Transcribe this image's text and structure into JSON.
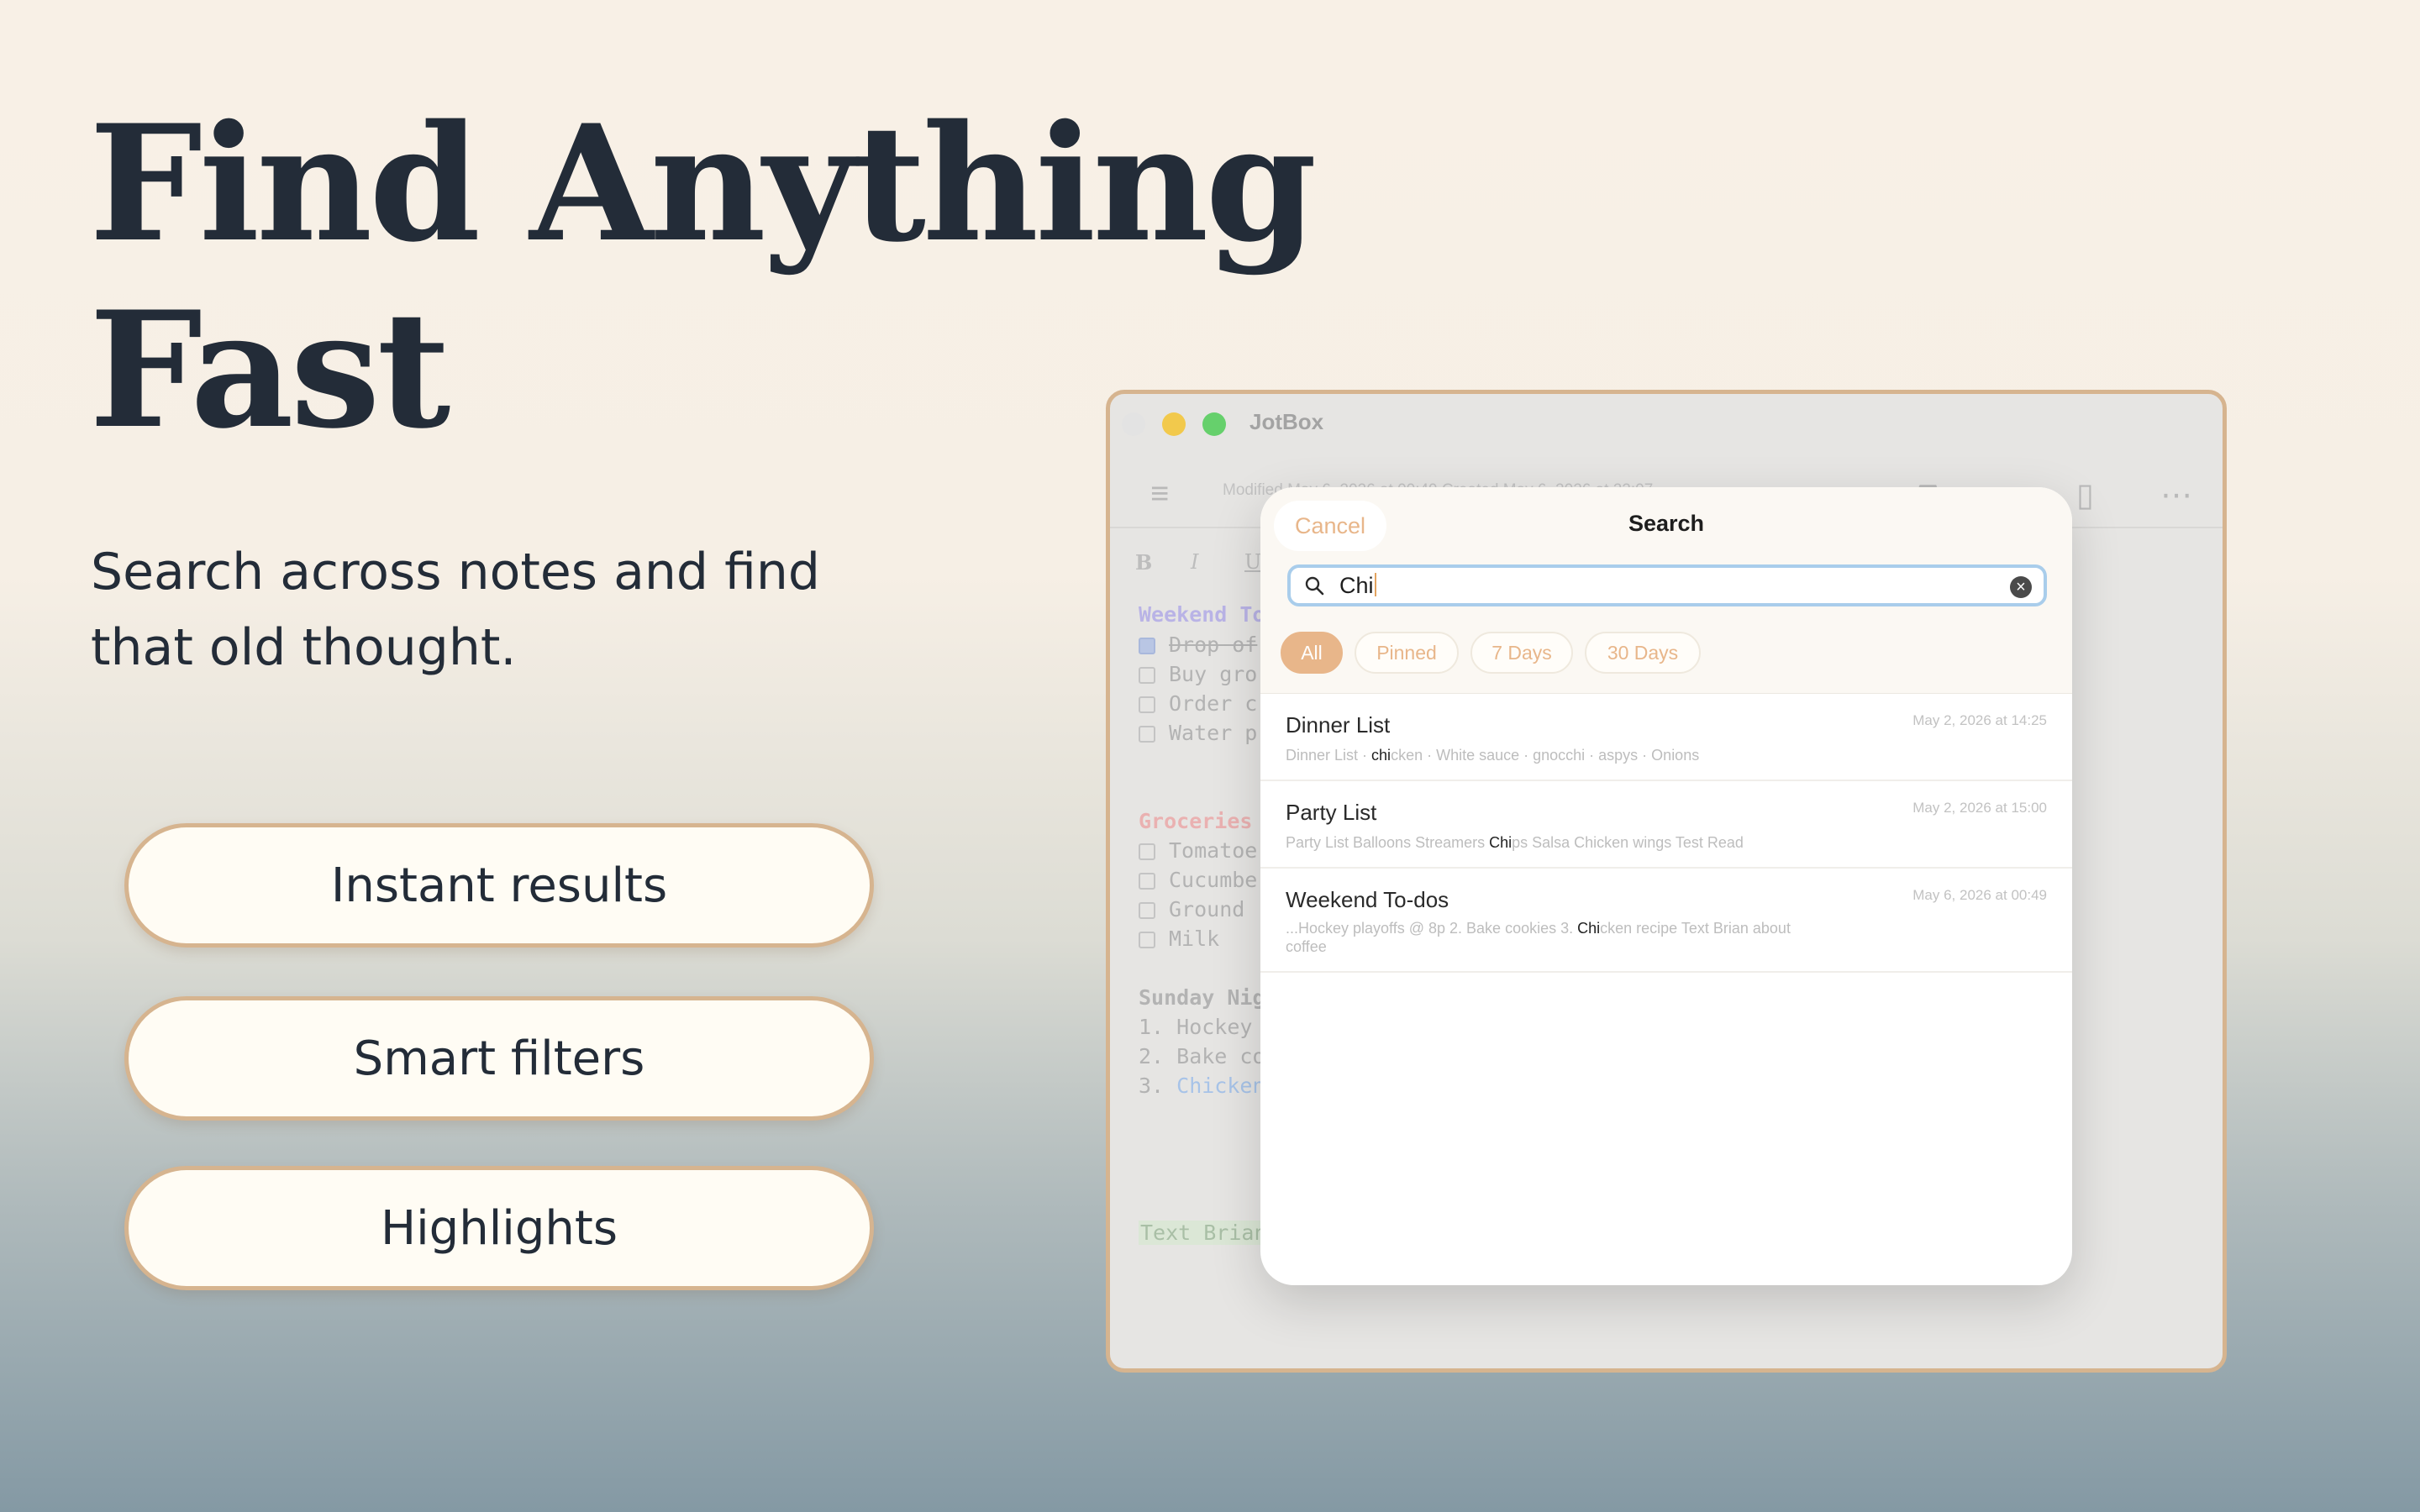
{
  "hero": {
    "title_line1": "Find Anything",
    "title_line2": "Fast",
    "subtitle_line1": "Search across notes and find",
    "subtitle_line2": "that old thought."
  },
  "features": [
    "Instant results",
    "Smart filters",
    "Highlights"
  ],
  "window": {
    "app_title": "JotBox",
    "meta_text": "Modified May 6, 2026 at 00:49    Created May 6, 2026 at 22:07",
    "format_buttons": [
      "B",
      "I",
      "U"
    ],
    "note_lines": [
      {
        "text": "Weekend To",
        "color": "#b9b3e6",
        "bold": true
      },
      {
        "text": "Drop of",
        "checkbox": true,
        "checked": true,
        "strike": true
      },
      {
        "text": "Buy gro",
        "checkbox": true
      },
      {
        "text": "Order c",
        "checkbox": true
      },
      {
        "text": "Water p",
        "checkbox": true
      },
      {
        "text": "Groceries",
        "color": "#eab1b1",
        "bold": true
      },
      {
        "text": "Tomatoe",
        "checkbox": true
      },
      {
        "text": "Cucumbe",
        "checkbox": true
      },
      {
        "text": "Ground",
        "checkbox": true
      },
      {
        "text": "Milk",
        "checkbox": true
      },
      {
        "text": "Sunday Nig",
        "bold": true
      },
      {
        "text": "1. Hockey"
      },
      {
        "text": "2. Bake co"
      },
      {
        "text": "3. Chicken",
        "partial_color": "#a7c3e8"
      },
      {
        "text": "Text Brian",
        "color": "#a9bfa6",
        "bg": "#dbe7d6"
      }
    ]
  },
  "search": {
    "cancel_label": "Cancel",
    "title": "Search",
    "query": "Chi",
    "clear_label": "×",
    "filters": [
      {
        "label": "All",
        "active": true
      },
      {
        "label": "Pinned",
        "active": false
      },
      {
        "label": "7 Days",
        "active": false
      },
      {
        "label": "30 Days",
        "active": false
      }
    ],
    "results": [
      {
        "title": "Dinner List",
        "date": "May 2, 2026 at 14:25",
        "snippet_before": "Dinner List · ",
        "snippet_match": "chi",
        "snippet_after": "cken · White sauce · gnocchi · aspys · Onions"
      },
      {
        "title": "Party List",
        "date": "May 2, 2026 at 15:00",
        "snippet_before": "Party List  Balloons  Streamers  ",
        "snippet_match": "Chi",
        "snippet_after": "ps  Salsa  Chicken wings Test Read"
      },
      {
        "title": "Weekend To-dos",
        "date": "May 6, 2026 at 00:49",
        "snippet_before": "...Hockey playoffs @ 8p 2. Bake cookies 3. ",
        "snippet_match": "Chi",
        "snippet_after": "cken recipe Text Brian about coffee"
      }
    ]
  },
  "colors": {
    "accent": "#e8b68a",
    "pill_border": "#d6b48f",
    "text_dark": "#232c38",
    "search_focus": "#a9cdeb"
  }
}
